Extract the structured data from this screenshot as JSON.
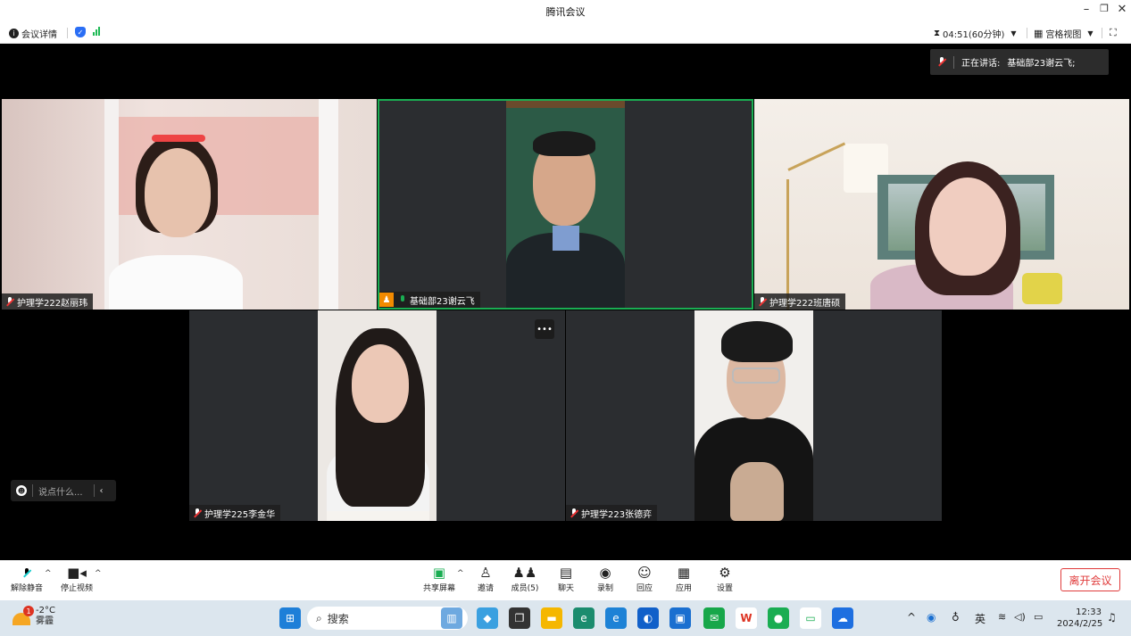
{
  "window": {
    "title": "腾讯会议"
  },
  "infobar": {
    "meeting_info": "会议详情",
    "timer": "04:51(60分钟)",
    "view": "宫格视图"
  },
  "speaking": {
    "label": "正在讲话:",
    "name": "基础部23谢云飞;"
  },
  "participants": [
    {
      "name": "护理学222赵丽玮",
      "muted": true
    },
    {
      "name": "基础部23谢云飞",
      "muted": false,
      "host": true
    },
    {
      "name": "护理学222班唐硕",
      "muted": true
    },
    {
      "name": "护理学225李金华",
      "muted": true
    },
    {
      "name": "护理学223张德弈",
      "muted": true
    }
  ],
  "chat": {
    "placeholder": "说点什么..."
  },
  "toolbar": {
    "unmute": "解除静音",
    "stop_video": "停止视频",
    "share": "共享屏幕",
    "invite": "邀请",
    "members": "成员(5)",
    "chat": "聊天",
    "record": "录制",
    "react": "回应",
    "apps": "应用",
    "settings": "设置",
    "leave": "离开会议"
  },
  "taskbar": {
    "weather_temp": "-2°C",
    "weather_desc": "雾霾",
    "weather_badge": "1",
    "search": "搜索",
    "ime": "英",
    "time": "12:33",
    "date": "2024/2/25"
  },
  "colors": {
    "active_border": "#1aad52",
    "leave": "#e03b3b",
    "tile_bg": "#2b2d30"
  }
}
